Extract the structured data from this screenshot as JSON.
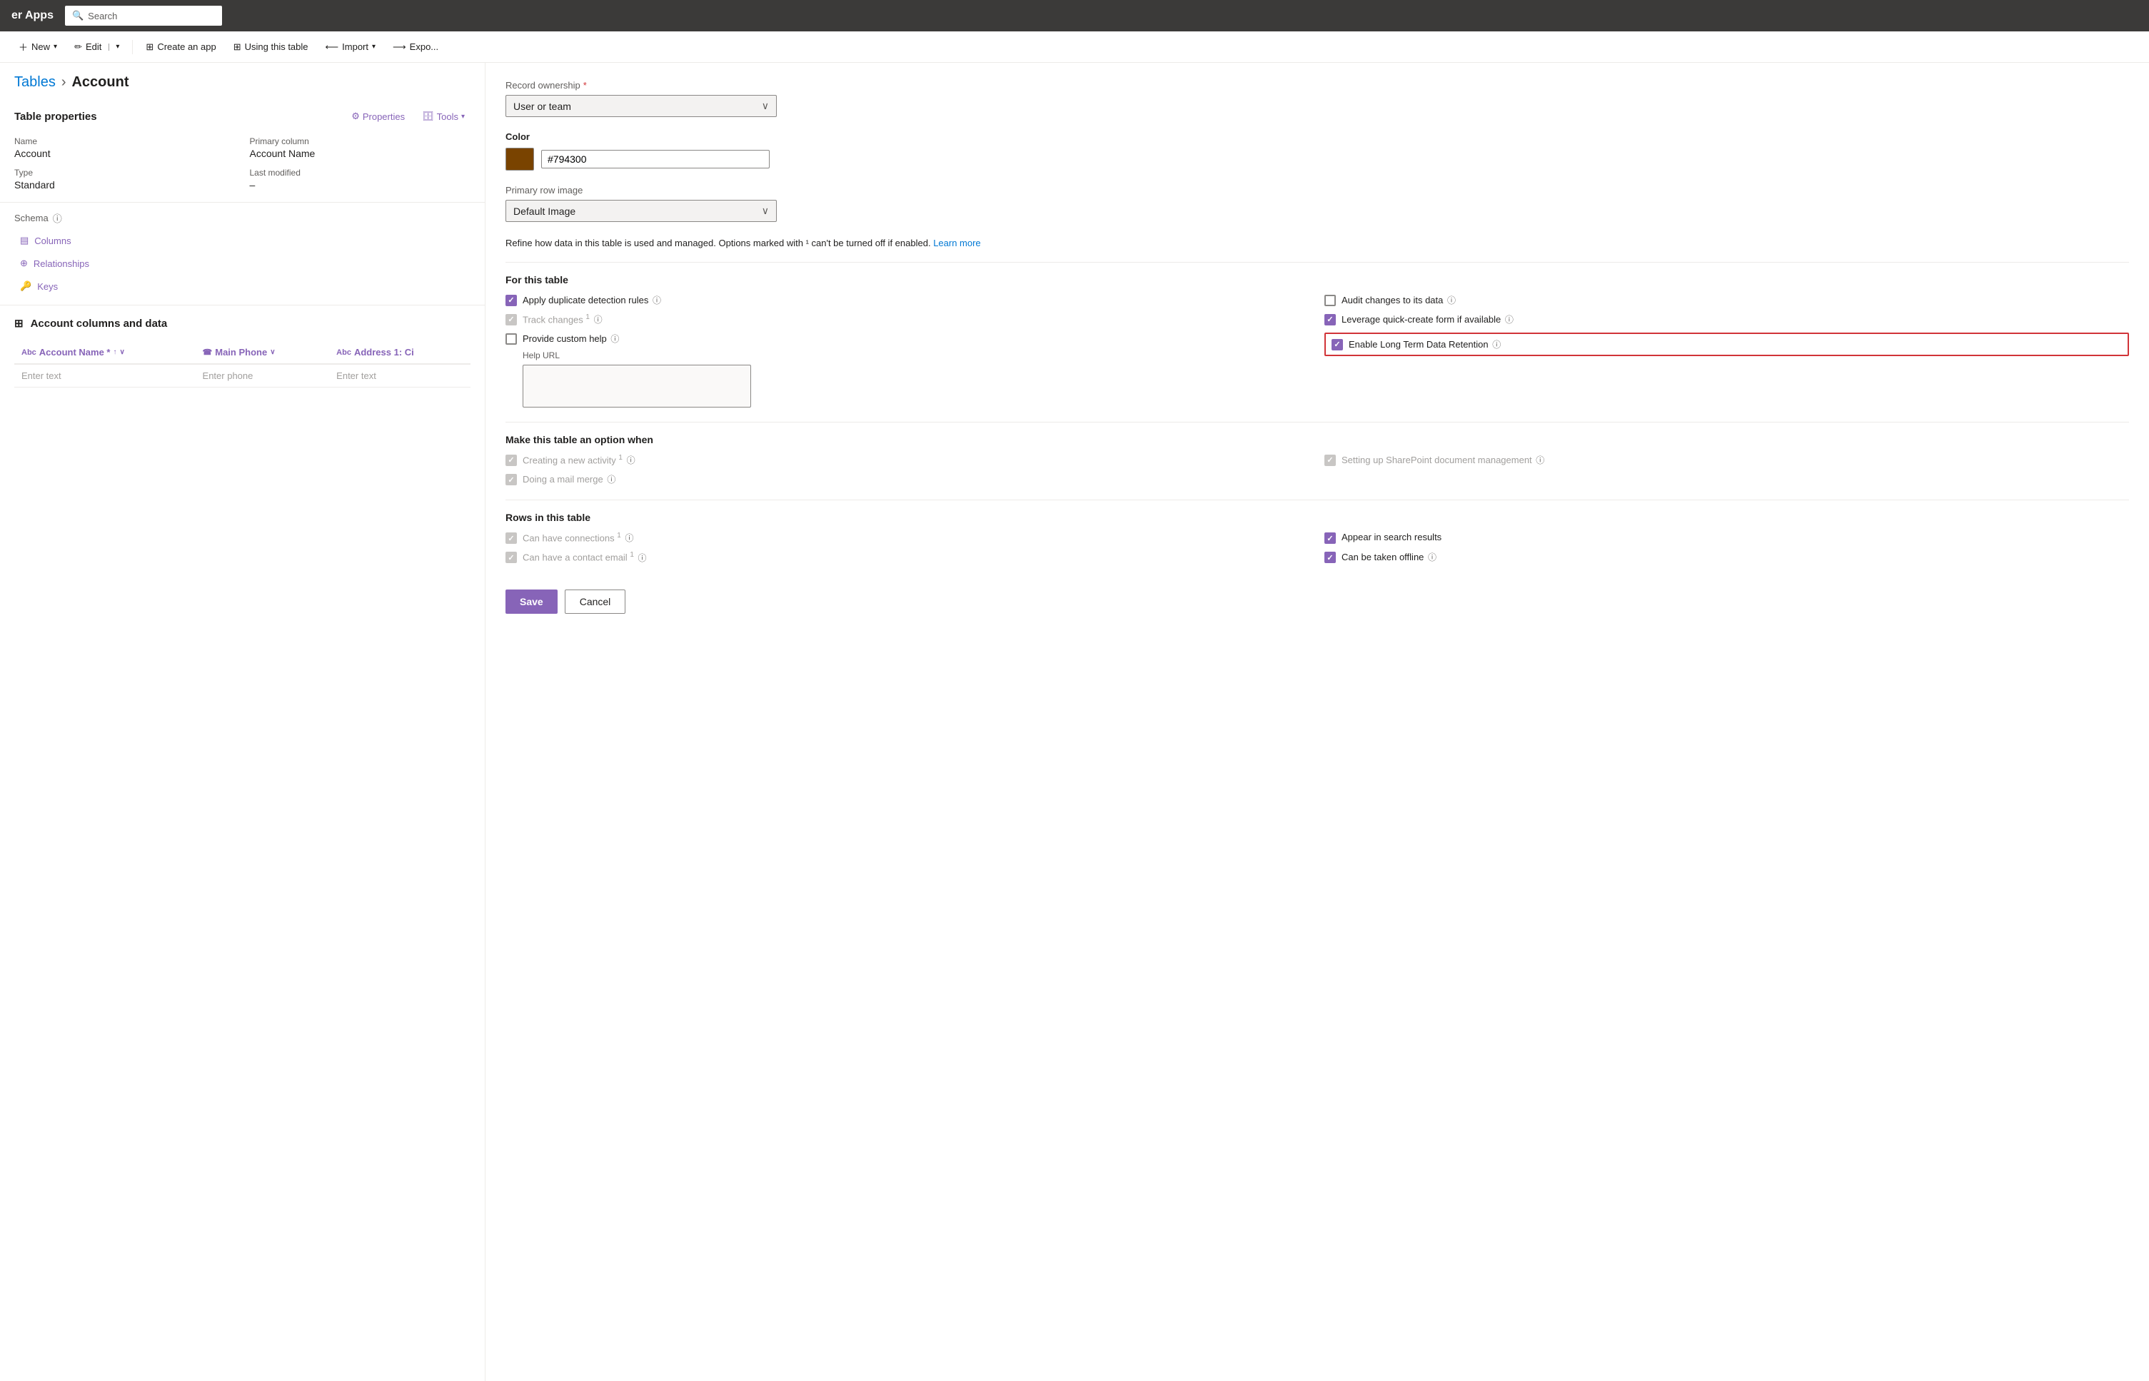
{
  "topBar": {
    "title": "er Apps",
    "searchPlaceholder": "Search"
  },
  "toolbar": {
    "newLabel": "New",
    "editLabel": "Edit",
    "createAppLabel": "Create an app",
    "usingTableLabel": "Using this table",
    "importLabel": "Import",
    "exportLabel": "Expo..."
  },
  "breadcrumb": {
    "parent": "Tables",
    "separator": "›",
    "current": "Account"
  },
  "tableProperties": {
    "title": "Table properties",
    "propertiesBtn": "Properties",
    "toolsBtn": "Tools",
    "nameLabel": "Name",
    "nameValue": "Account",
    "typeLabel": "Type",
    "typeValue": "Standard",
    "primaryColumnLabel": "Primary column",
    "primaryColumnValue": "Account Name",
    "lastModifiedLabel": "Last modified",
    "lastModifiedValue": "–"
  },
  "schema": {
    "title": "Schema",
    "items": [
      {
        "id": "columns",
        "label": "Columns",
        "icon": "▤"
      },
      {
        "id": "relationships",
        "label": "Relationships",
        "icon": "⊕"
      },
      {
        "id": "keys",
        "label": "Keys",
        "icon": "🔑"
      }
    ]
  },
  "dataSection": {
    "title": "Account columns and data",
    "tableIcon": "⊞",
    "columns": [
      {
        "id": "accountName",
        "label": "Account Name *",
        "type": "Abc",
        "sortable": true
      },
      {
        "id": "mainPhone",
        "label": "Main Phone",
        "type": "☎"
      },
      {
        "id": "address",
        "label": "Address 1: Ci",
        "type": "Abc"
      }
    ],
    "rows": [
      {
        "accountName": "Enter text",
        "mainPhone": "Enter phone",
        "address": "Enter text"
      }
    ]
  },
  "rightPanel": {
    "recordOwnership": {
      "label": "Record ownership",
      "required": true,
      "value": "User or team"
    },
    "color": {
      "label": "Color",
      "hex": "#794300",
      "swatchColor": "#794300"
    },
    "primaryRowImage": {
      "label": "Primary row image",
      "value": "Default Image"
    },
    "infoText": "Refine how data in this table is used and managed. Options marked with ¹ can't be turned off if enabled.",
    "learnMore": "Learn more",
    "forThisTable": {
      "title": "For this table",
      "checkboxes": [
        {
          "id": "applyDuplicate",
          "label": "Apply duplicate detection rules",
          "checked": true,
          "disabled": false,
          "hasInfo": true,
          "superscript": false
        },
        {
          "id": "auditChanges",
          "label": "Audit changes to its data",
          "checked": false,
          "disabled": false,
          "hasInfo": true,
          "superscript": false
        },
        {
          "id": "trackChanges",
          "label": "Track changes",
          "checked": false,
          "disabled": true,
          "hasInfo": true,
          "superscript": true
        },
        {
          "id": "leverageQuick",
          "label": "Leverage quick-create form if available",
          "checked": true,
          "disabled": false,
          "hasInfo": true,
          "superscript": false
        },
        {
          "id": "provideCustomHelp",
          "label": "Provide custom help",
          "checked": false,
          "disabled": false,
          "hasInfo": true,
          "superscript": false
        },
        {
          "id": "enableLongTerm",
          "label": "Enable Long Term Data Retention",
          "checked": true,
          "disabled": false,
          "hasInfo": true,
          "superscript": false,
          "highlighted": true
        }
      ],
      "helpUrlLabel": "Help URL"
    },
    "makeTableOption": {
      "title": "Make this table an option when",
      "checkboxes": [
        {
          "id": "creatingActivity",
          "label": "Creating a new activity",
          "checked": true,
          "disabled": true,
          "hasInfo": true,
          "superscript": true
        },
        {
          "id": "settingUpSharePoint",
          "label": "Setting up SharePoint document management",
          "checked": true,
          "disabled": true,
          "hasInfo": true,
          "superscript": false
        },
        {
          "id": "doingMailMerge",
          "label": "Doing a mail merge",
          "checked": true,
          "disabled": true,
          "hasInfo": true,
          "superscript": false
        }
      ]
    },
    "rowsInTable": {
      "title": "Rows in this table",
      "checkboxes": [
        {
          "id": "canHaveConnections",
          "label": "Can have connections",
          "checked": true,
          "disabled": true,
          "hasInfo": true,
          "superscript": true
        },
        {
          "id": "appearInSearch",
          "label": "Appear in search results",
          "checked": true,
          "disabled": false,
          "hasInfo": false,
          "superscript": false
        },
        {
          "id": "canHaveContactEmail",
          "label": "Can have a contact email",
          "checked": true,
          "disabled": true,
          "hasInfo": true,
          "superscript": true
        },
        {
          "id": "canBeTakenOffline",
          "label": "Can be taken offline",
          "checked": true,
          "disabled": false,
          "hasInfo": true,
          "superscript": false
        }
      ]
    },
    "saveBtn": "Save",
    "cancelBtn": "Cancel"
  }
}
